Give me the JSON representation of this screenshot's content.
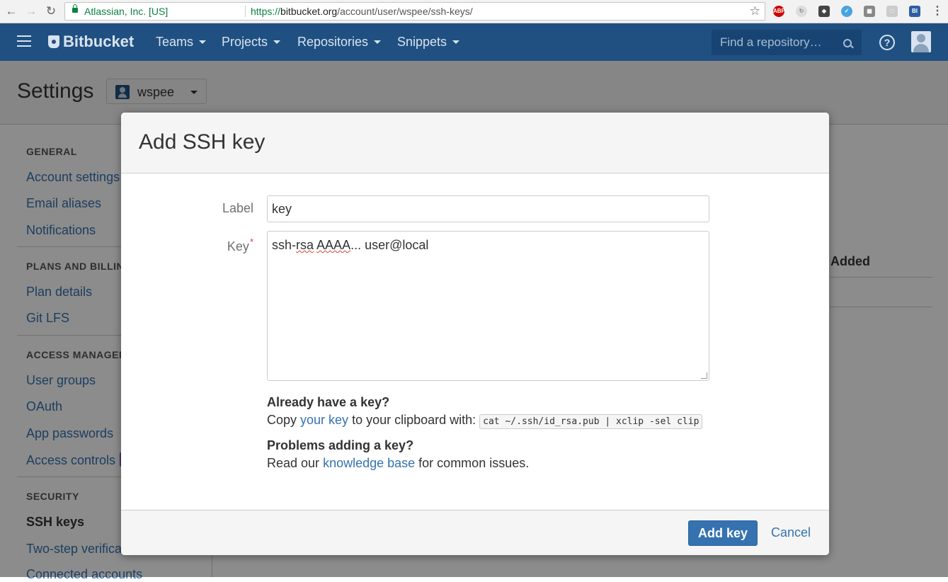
{
  "browser": {
    "org": "Atlassian, Inc. [US]",
    "url_scheme": "https://",
    "url_host": "bitbucket.org",
    "url_path": "/account/user/wspee/ssh-keys/"
  },
  "header": {
    "logo": "Bitbucket",
    "nav": [
      "Teams",
      "Projects",
      "Repositories",
      "Snippets"
    ],
    "search_placeholder": "Find a repository…",
    "brand_color": "#205081"
  },
  "page": {
    "title": "Settings",
    "account": "wspee"
  },
  "sidebar": {
    "sections": [
      {
        "heading": "GENERAL",
        "items": [
          "Account settings",
          "Email aliases",
          "Notifications"
        ]
      },
      {
        "heading": "PLANS AND BILLIN",
        "items": [
          "Plan details",
          "Git LFS"
        ]
      },
      {
        "heading": "ACCESS MANAGEM",
        "items": [
          "User groups",
          "OAuth",
          "App passwords",
          "Access controls"
        ]
      },
      {
        "heading": "SECURITY",
        "items": [
          "SSH keys",
          "Two-step verifica",
          "Connected accounts"
        ]
      }
    ],
    "active": "SSH keys"
  },
  "main": {
    "column_added": "Added"
  },
  "dialog": {
    "title": "Add SSH key",
    "label_field": {
      "label": "Label",
      "value": "key"
    },
    "key_field": {
      "label": "Key",
      "required_mark": "*",
      "value_part1": "ssh-",
      "value_part2": "rsa",
      "value_part3": " ",
      "value_part4": "AAAA",
      "value_part5": "... user@local"
    },
    "help1": {
      "heading": "Already have a key?",
      "text_before": "Copy ",
      "link": "your key",
      "text_after": " to your clipboard with: ",
      "command": "cat ~/.ssh/id_rsa.pub | xclip -sel clip"
    },
    "help2": {
      "heading": "Problems adding a key?",
      "text_before": "Read our ",
      "link": "knowledge base",
      "text_after": " for common issues."
    },
    "submit": "Add key",
    "cancel": "Cancel",
    "accent_color": "#3572b0"
  }
}
